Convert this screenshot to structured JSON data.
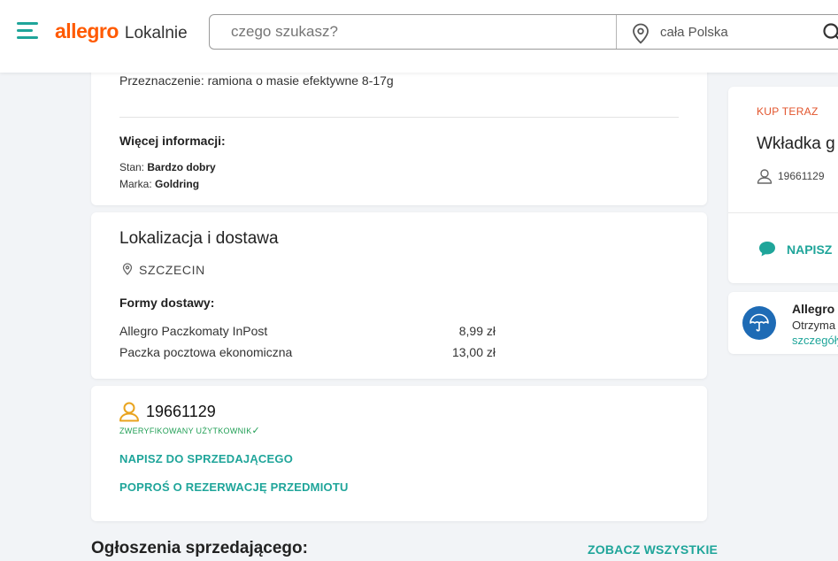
{
  "header": {
    "logo_brand": "allegro",
    "logo_sub": "Lokalnie",
    "search_placeholder": "czego szukasz?",
    "location": "cała Polska"
  },
  "description": {
    "purpose": "Przeznaczenie: ramiona o masie efektywne 8-17g",
    "more_info_title": "Więcej informacji:",
    "condition_label": "Stan:",
    "condition_value": "Bardzo dobry",
    "brand_label": "Marka:",
    "brand_value": "Goldring"
  },
  "location_delivery": {
    "title": "Lokalizacja i dostawa",
    "city": "SZCZECIN",
    "forms_title": "Formy dostawy:",
    "options": [
      {
        "name": "Allegro Paczkomaty InPost",
        "price": "8,99 zł"
      },
      {
        "name": "Paczka pocztowa ekonomiczna",
        "price": "13,00 zł"
      }
    ]
  },
  "seller": {
    "id": "19661129",
    "verified": "ZWERYFIKOWANY UŻYTKOWNIK",
    "verified_mark": "✓",
    "write_link": "NAPISZ DO SPRZEDAJĄCEGO",
    "reserve_link": "POPROŚ O REZERWACJĘ PRZEDMIOTU"
  },
  "seller_listings": {
    "title": "Ogłoszenia sprzedającego:",
    "see_all": "ZOBACZ WSZYSTKIE"
  },
  "sidebar": {
    "buy_now": "KUP TERAZ",
    "title": "Wkładka g",
    "user": "19661129",
    "write": "NAPISZ"
  },
  "protection": {
    "title": "Allegro",
    "text": "Otrzyma",
    "link": "szczegóły"
  },
  "colors": {
    "brand_orange": "#ff5a00",
    "accent_teal": "#1fa59a",
    "verified_green": "#1f9e54",
    "buy_now": "#e2542c",
    "protection_blue": "#1e6bb5"
  }
}
